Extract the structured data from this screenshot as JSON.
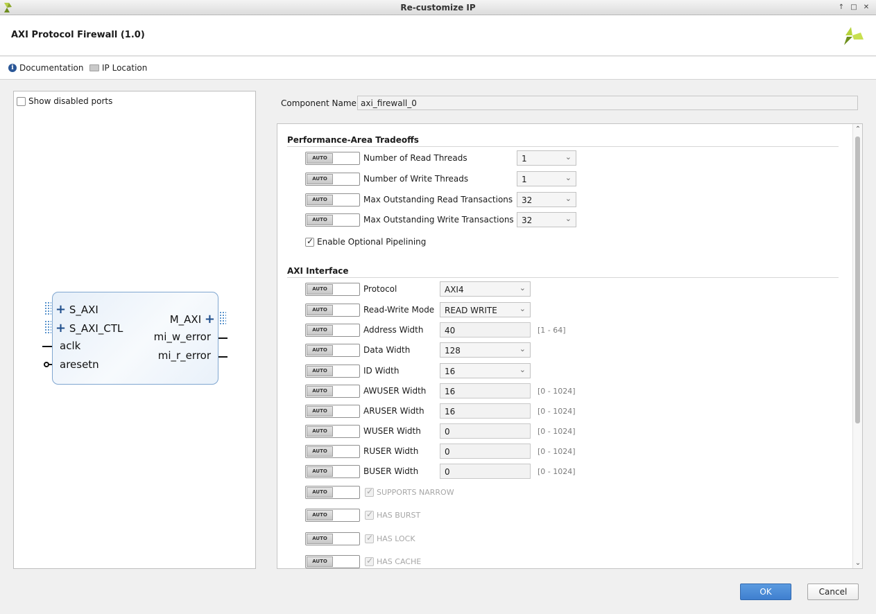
{
  "window": {
    "title": "Re-customize IP",
    "controls": [
      "↑",
      "□",
      "✕"
    ]
  },
  "header": {
    "ip_title": "AXI Protocol Firewall (1.0)"
  },
  "links": {
    "documentation": "Documentation",
    "ip_location": "IP Location"
  },
  "left_panel": {
    "show_disabled_ports": {
      "label": "Show disabled ports",
      "checked": false
    },
    "block": {
      "left_ports": [
        "S_AXI",
        "S_AXI_CTL",
        "aclk",
        "aresetn"
      ],
      "right_ports": [
        "M_AXI",
        "mi_w_error",
        "mi_r_error"
      ]
    }
  },
  "component": {
    "label": "Component Name",
    "value": "axi_firewall_0"
  },
  "auto_label": "AUTO",
  "sections": {
    "performance": {
      "title": "Performance-Area Tradeoffs",
      "params": [
        {
          "label": "Number of Read Threads",
          "value": "1"
        },
        {
          "label": "Number of Write Threads",
          "value": "1"
        },
        {
          "label": "Max Outstanding Read Transactions",
          "value": "32"
        },
        {
          "label": "Max Outstanding Write Transactions",
          "value": "32"
        }
      ],
      "pipelining": {
        "label": "Enable Optional Pipelining",
        "checked": true
      }
    },
    "axi": {
      "title": "AXI Interface",
      "params": [
        {
          "label": "Protocol",
          "value": "AXI4",
          "kind": "combo"
        },
        {
          "label": "Read-Write Mode",
          "value": "READ WRITE",
          "kind": "combo"
        },
        {
          "label": "Address Width",
          "value": "40",
          "kind": "text",
          "range": "[1 - 64]"
        },
        {
          "label": "Data Width",
          "value": "128",
          "kind": "combo"
        },
        {
          "label": "ID Width",
          "value": "16",
          "kind": "combo"
        },
        {
          "label": "AWUSER Width",
          "value": "16",
          "kind": "text",
          "range": "[0 - 1024]"
        },
        {
          "label": "ARUSER Width",
          "value": "16",
          "kind": "text",
          "range": "[0 - 1024]"
        },
        {
          "label": "WUSER Width",
          "value": "0",
          "kind": "text",
          "range": "[0 - 1024]"
        },
        {
          "label": "RUSER Width",
          "value": "0",
          "kind": "text",
          "range": "[0 - 1024]"
        },
        {
          "label": "BUSER Width",
          "value": "0",
          "kind": "text",
          "range": "[0 - 1024]"
        }
      ],
      "flags": [
        {
          "label": "SUPPORTS NARROW",
          "checked": true
        },
        {
          "label": "HAS BURST",
          "checked": true
        },
        {
          "label": "HAS LOCK",
          "checked": true
        },
        {
          "label": "HAS CACHE",
          "checked": true
        }
      ]
    }
  },
  "buttons": {
    "ok": "OK",
    "cancel": "Cancel"
  },
  "colors": {
    "accent": "#3f7fcf",
    "block_border": "#7fa6d0",
    "brand_green": "#8dbf2c"
  }
}
